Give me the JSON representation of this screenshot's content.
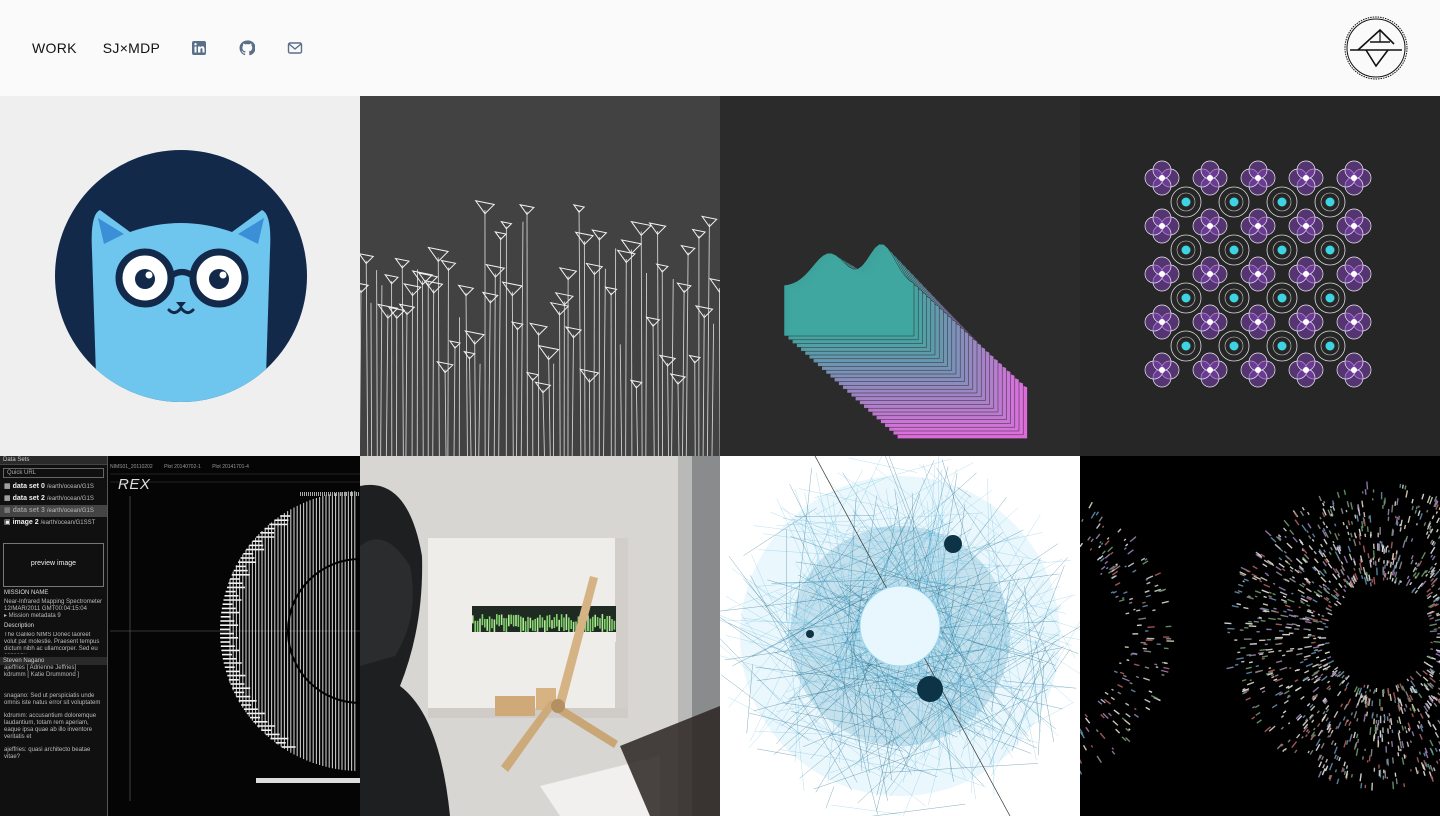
{
  "nav": {
    "work": "WORK",
    "collab": "SJ×MDP"
  },
  "social": [
    "linkedin-icon",
    "github-icon",
    "mail-icon"
  ],
  "colors": {
    "header_bg": "#fafafa",
    "cat_circle": "#12294a",
    "cat_body": "#6ec6ef",
    "wave_top": "#e26fe0",
    "wave_side": "#3fa7a0",
    "pattern_accent": "#3fd2e0",
    "pattern_petal": "#7b3fb0",
    "network_blue": "#1a7fae"
  },
  "rex": {
    "panel_title": "Data Sets",
    "quick_url": "Quick URL",
    "datasets": [
      {
        "name": "data set 0",
        "path": "/earth/ocean/G1S"
      },
      {
        "name": "data set 2",
        "path": "/earth/ocean/G1S"
      },
      {
        "name": "data set 3",
        "path": "/earth/ocean/G1S"
      },
      {
        "name": "image 2",
        "path": "/earth/ocean/G1SST"
      }
    ],
    "preview": "preview image",
    "mission_name_label": "MISSION NAME",
    "mission_name": "Near-Infrared Mapping Spectrometer",
    "mission_date": "12/MAR/2011 GMT00:04:15:04",
    "mission_meta": "▸ Mission metadata 9",
    "description_label": "Description",
    "description": "The Galileo NIMS Donec laoreet volut pat molestie. Praesent tempus dictum nibh ac ullamcorper. Sed eu consequ",
    "chat_title": "Steven Nagano",
    "chat_users": [
      "ajeffries [ Adrienne Jeffries]",
      "kdrumm [ Katie Drummond ]"
    ],
    "messages": [
      "snagano: Sed ut perspiciatis unde omnis iste natus error sit voluptatem",
      "kdrumm: accusantium doloremque laudantium, totam rem aperiam, eaque ipsa quae ab illo inventore veritatis et",
      "ajeffries: quasi architecto beatae vitae?"
    ],
    "title": "REX",
    "tabs": [
      "NIMS01_20110202",
      "Plot 20140702-1",
      "Plot 20141701-4"
    ]
  }
}
